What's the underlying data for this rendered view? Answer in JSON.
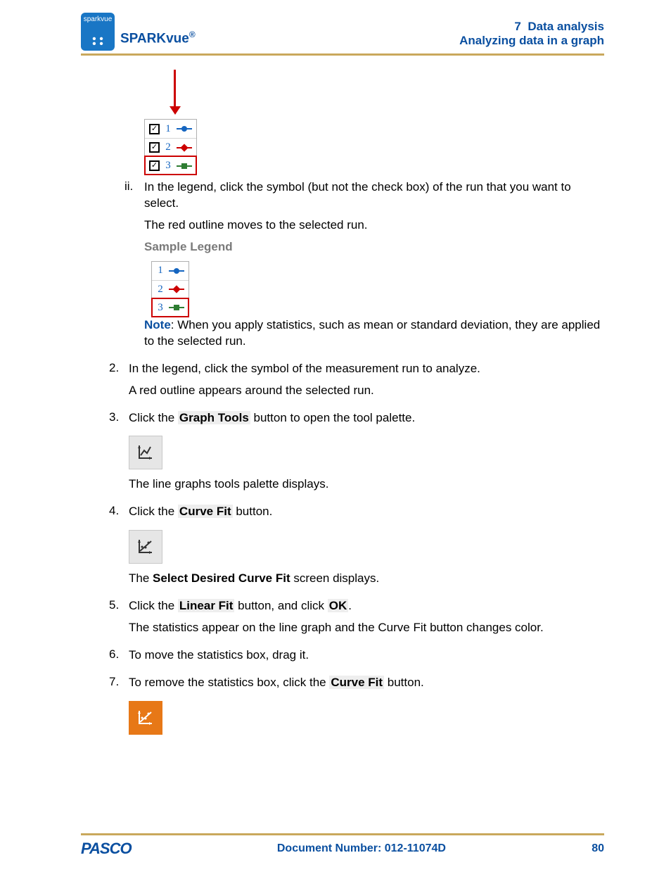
{
  "header": {
    "logo_text": "sparkvue",
    "brand": "SPARKvue",
    "section_num": "7",
    "section_title": "Data analysis",
    "subsection": "Analyzing data in a graph"
  },
  "legend1": {
    "rows": [
      {
        "n": "1",
        "color": "blue",
        "checked": true,
        "selected": false
      },
      {
        "n": "2",
        "color": "red",
        "checked": true,
        "selected": false
      },
      {
        "n": "3",
        "color": "green",
        "checked": true,
        "selected": true
      }
    ]
  },
  "step_ii": {
    "marker": "ii.",
    "p1": "In the legend, click the symbol (but not the check box) of the run that you want to select.",
    "p2": "The red outline moves to the selected run.",
    "sample": "Sample Legend"
  },
  "legend2": {
    "rows": [
      {
        "n": "1",
        "color": "blue",
        "selected": false
      },
      {
        "n": "2",
        "color": "red",
        "selected": false
      },
      {
        "n": "3",
        "color": "green",
        "selected": true
      }
    ]
  },
  "note": {
    "label": "Note",
    "text": ": When you apply statistics, such as mean or standard deviation, they are applied to the selected run."
  },
  "s2": {
    "n": "2.",
    "p1": "In the legend, click the symbol of the measurement run to analyze.",
    "p2": "A red outline appears around the selected run."
  },
  "s3": {
    "n": "3.",
    "pre": "Click the ",
    "bold": "Graph Tools",
    "post": " button to open the tool palette.",
    "after": "The line graphs tools palette displays."
  },
  "s4": {
    "n": "4.",
    "pre": "Click the ",
    "bold": "Curve Fit",
    "post": " button.",
    "after_pre": "The ",
    "after_bold": "Select Desired Curve Fit",
    "after_post": " screen displays."
  },
  "s5": {
    "n": "5.",
    "pre": "Click the ",
    "b1": "Linear Fit",
    "mid": " button, and click ",
    "b2": "OK",
    "post": ".",
    "after": "The statistics appear on the line graph and the Curve Fit button changes color."
  },
  "s6": {
    "n": "6.",
    "t": "To move the statistics box, drag it."
  },
  "s7": {
    "n": "7.",
    "pre": "To remove the statistics box, click the ",
    "bold": "Curve Fit",
    "post": " button."
  },
  "footer": {
    "logo": "PASCO",
    "doc": "Document Number: 012-11074D",
    "page": "80"
  }
}
